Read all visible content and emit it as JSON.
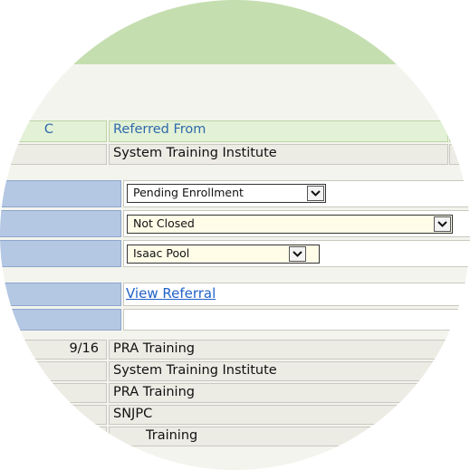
{
  "header": {
    "col1_partial": "C",
    "col2": "Referred From"
  },
  "detail": {
    "referred_from": "System Training Institute",
    "status_select": "Pending Enrollment",
    "closed_select": "Not Closed",
    "staff_select": "Isaac Pool",
    "view_referral_link": "View Referral"
  },
  "rows": [
    {
      "left": "9/16",
      "right": "PRA Training"
    },
    {
      "left": "",
      "right": "System Training Institute"
    },
    {
      "left": "",
      "right": "PRA Training"
    },
    {
      "left": "",
      "right": "SNJPC"
    },
    {
      "left": "",
      "right": "Training"
    }
  ],
  "icons": {
    "dropdown": "chevron-down-icon"
  },
  "colors": {
    "banner": "#c5deb0",
    "header_bg": "#e3f1d6",
    "header_text": "#2e6aab",
    "label_cell": "#b4c7e3",
    "link": "#2262c8",
    "select_bg": "#fffce8"
  }
}
